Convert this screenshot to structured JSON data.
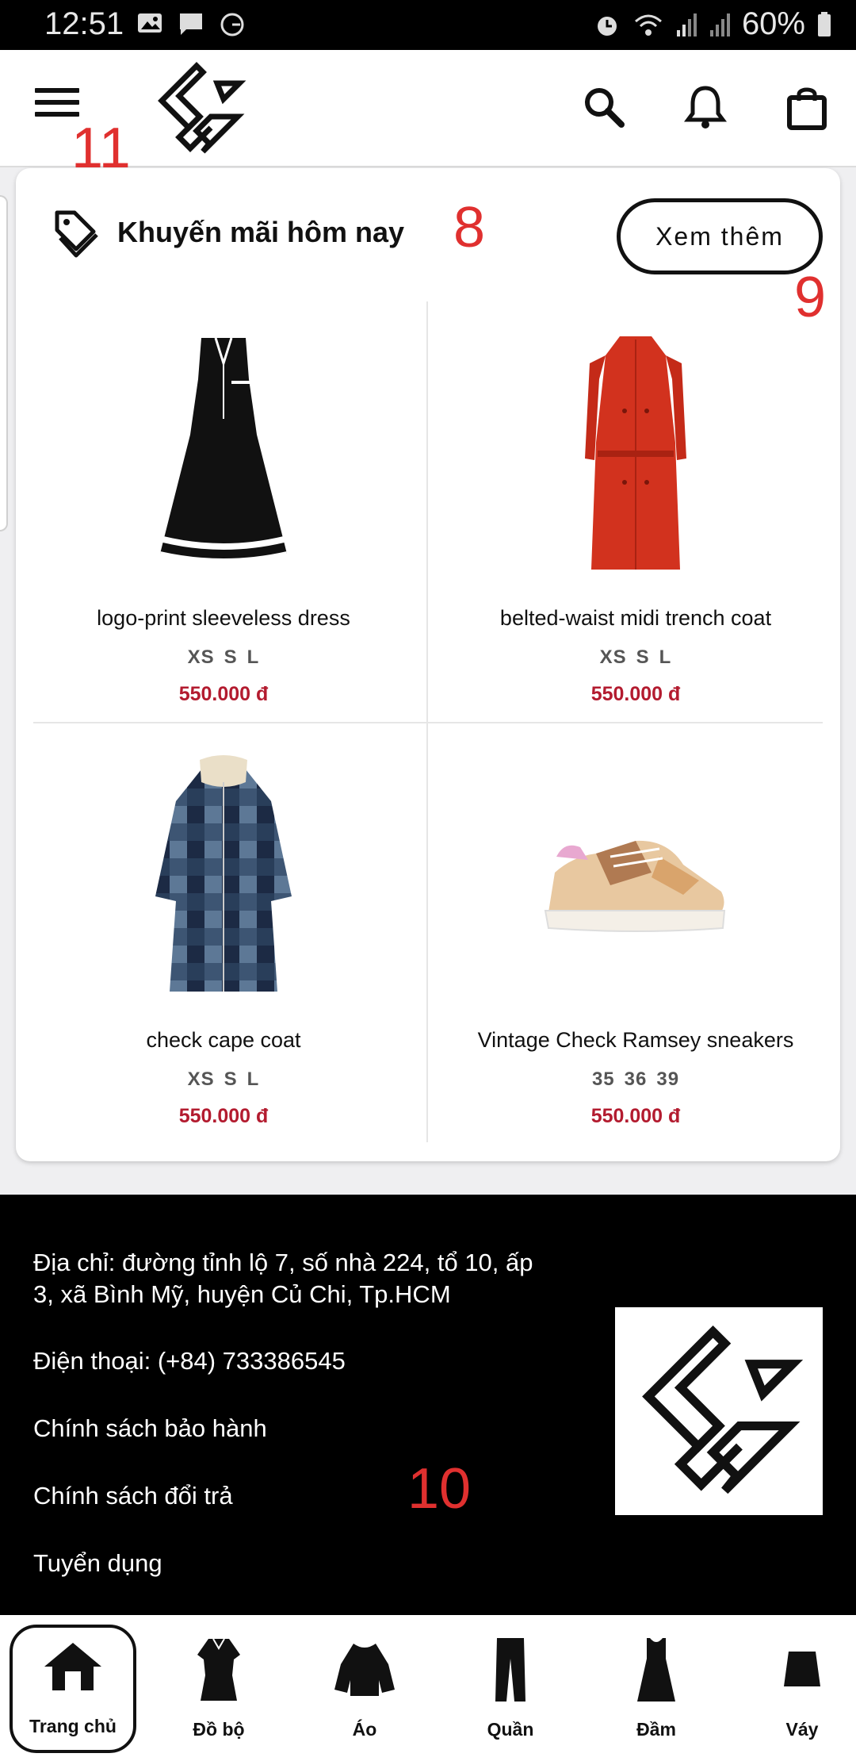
{
  "status_bar": {
    "time": "12:51",
    "battery_text": "60%",
    "icons_left": [
      "image-icon",
      "message-icon",
      "g-icon"
    ],
    "icons_right": [
      "alarm-icon",
      "wifi-icon",
      "signal-icon",
      "signal2-icon",
      "battery-icon"
    ]
  },
  "header": {
    "menu_icon": "hamburger-menu-icon",
    "logo": "brand-logo",
    "icons": [
      "search-icon",
      "bell-icon",
      "shopping-bag-icon"
    ]
  },
  "promo": {
    "title": "Khuyến mãi hôm nay",
    "more_label": "Xem thêm",
    "products": [
      {
        "name": "logo-print sleeveless dress",
        "sizes": [
          "XS",
          "S",
          "L"
        ],
        "price": "550.000 đ"
      },
      {
        "name": "belted-waist midi trench coat",
        "sizes": [
          "XS",
          "S",
          "L"
        ],
        "price": "550.000 đ"
      },
      {
        "name": "check cape coat",
        "sizes": [
          "XS",
          "S",
          "L"
        ],
        "price": "550.000 đ"
      },
      {
        "name": "Vintage Check Ramsey sneakers",
        "sizes": [
          "35",
          "36",
          "39"
        ],
        "price": "550.000 đ"
      }
    ]
  },
  "annotations": {
    "a8": "8",
    "a9": "9",
    "a10": "10",
    "a11": "11"
  },
  "footer": {
    "address_line1": "Địa chỉ: đường tỉnh lộ 7, số nhà 224, tổ 10, ấp",
    "address_line2": "3, xã Bình Mỹ, huyện Củ Chi, Tp.HCM",
    "phone": "Điện thoại: (+84) 733386545",
    "warranty": "Chính sách bảo hành",
    "returns": "Chính sách đổi trả",
    "careers": "Tuyển dụng"
  },
  "bottom_nav": {
    "items": [
      {
        "label": "Trang chủ",
        "icon": "home-icon",
        "active": true
      },
      {
        "label": "Đồ bộ",
        "icon": "set-outfit-icon",
        "active": false
      },
      {
        "label": "Áo",
        "icon": "shirt-icon",
        "active": false
      },
      {
        "label": "Quần",
        "icon": "pants-icon",
        "active": false
      },
      {
        "label": "Đầm",
        "icon": "dress-icon",
        "active": false
      },
      {
        "label": "Váy",
        "icon": "skirt-icon",
        "active": false
      }
    ]
  },
  "colors": {
    "price": "#b31b2f",
    "annotation": "#e0302f",
    "footer_bg": "#000000"
  }
}
